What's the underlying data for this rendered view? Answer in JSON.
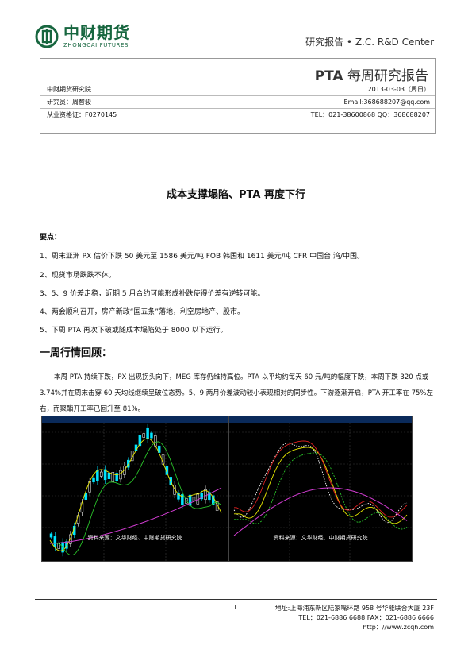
{
  "header": {
    "brand_cn": "中财期货",
    "brand_en": "ZHONGCAI FUTURES",
    "right_text": "研究报告 •  Z.C.   R&D Center"
  },
  "info": {
    "title_bold": "PTA",
    "title_rest": " 每周研究报告",
    "institute": "中财期货研究院",
    "date": "2013-03-03（周日）",
    "researcher": "研究员：周智骏",
    "email": "Email:368688207@qq.com",
    "cert": "从业资格证：F0270145",
    "contact": "TEL：021-38600868   QQ：368688207"
  },
  "article": {
    "title": "成本支撑塌陷、PTA 再度下行",
    "key_points_label": "要点：",
    "key_points": [
      "1、周末亚洲 PX 估价下跌 50 美元至 1586 美元/吨 FOB 韩国和 1611 美元/吨 CFR 中国台  湾/中国。",
      "2、现货市场跌跌不休。",
      "3、5、9 价差走稳，近期 5 月合约可能形成补跌使得价差有逆转可能。",
      "4、两会顺利召开，房产新政“国五条”落地，利空房地产、股市。",
      "5、下周 PTA 再次下破或随成本塌陷处于 8000 以下运行。"
    ],
    "section_title": "一周行情回顾：",
    "paragraph": "本周 PTA 持续下跌，PX 出现拐头向下，MEG 库存仍维持高位。PTA 以平均约每天 60 元/吨的幅度下跌，本周下跌 320 点或 3.74%并在周末击穿 60 天均线继续呈破位态势。5、9 两月价差波动较小表现相对的同步性。下游逐渐开启，PTA 开工率在 75%左右，而聚酯开工率已回升至 81%。"
  },
  "charts": {
    "source_left": "资料来源：文华财经、中财期货研究院",
    "source_right": "资料来源：文华财经、中财期货研究院"
  },
  "colors": {
    "brand_green": "#17663f",
    "candle_up": "#00e5ff",
    "ma_yellow": "#e8e800",
    "ma_magenta": "#d23cd2",
    "ma_green": "#29c229",
    "ma_red": "#e02020"
  },
  "footer": {
    "page": "1",
    "address": "地址:上海浦东新区陆家嘴环路 958 号华能联合大厦 23F",
    "phone": "TEL：021-6886 6688 FAX：021-6886 6666",
    "url": "http：//www.zcqh.com"
  }
}
